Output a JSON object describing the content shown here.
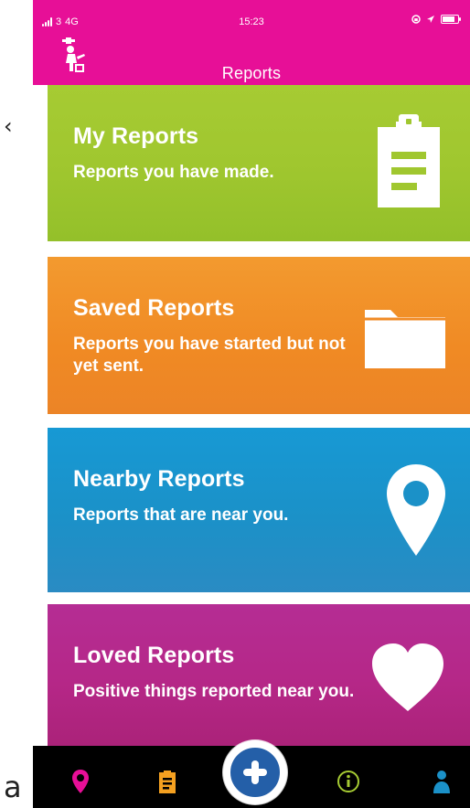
{
  "outside": {
    "top_glyph": "‹",
    "bottom_glyph": "a"
  },
  "status_bar": {
    "carrier": "3",
    "network": "4G",
    "time": "15:23"
  },
  "header": {
    "title": "Reports"
  },
  "cards": [
    {
      "title": "My Reports",
      "description": "Reports you have made.",
      "icon": "clipboard-icon",
      "color": "#a0c72f"
    },
    {
      "title": "Saved Reports",
      "description": "Reports you have started but not yet sent.",
      "icon": "folder-icon",
      "color": "#f08a24"
    },
    {
      "title": "Nearby Reports",
      "description": "Reports that are near you.",
      "icon": "location-pin-icon",
      "color": "#1b91c8"
    },
    {
      "title": "Loved Reports",
      "description": "Positive things reported near you.",
      "icon": "heart-icon",
      "color": "#b52787"
    }
  ],
  "tabbar": {
    "tabs": [
      {
        "icon": "location-pin-icon",
        "color": "#e70f97"
      },
      {
        "icon": "clipboard-icon",
        "color": "#f4a020"
      },
      {
        "icon": "plus-icon",
        "color": "#245fa8"
      },
      {
        "icon": "info-icon",
        "color": "#a6cb33"
      },
      {
        "icon": "person-icon",
        "color": "#1b91c8"
      }
    ]
  }
}
